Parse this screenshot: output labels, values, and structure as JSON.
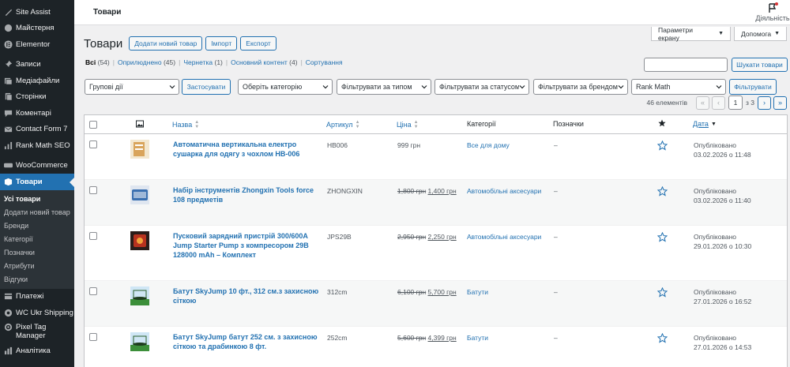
{
  "sidebar": {
    "items": [
      {
        "label": "Site Assist",
        "icon": "site-assist-icon"
      },
      {
        "label": "Майстерня",
        "icon": "dashboard-icon"
      },
      {
        "label": "Elementor",
        "icon": "elementor-icon"
      },
      {
        "label": "Записи",
        "icon": "pin-icon"
      },
      {
        "label": "Медіафайли",
        "icon": "media-icon"
      },
      {
        "label": "Сторінки",
        "icon": "pages-icon"
      },
      {
        "label": "Коментарі",
        "icon": "comments-icon"
      },
      {
        "label": "Contact Form 7",
        "icon": "mail-icon"
      },
      {
        "label": "Rank Math SEO",
        "icon": "rank-math-icon"
      },
      {
        "label": "WooCommerce",
        "icon": "woocommerce-icon"
      },
      {
        "label": "Товари",
        "icon": "products-icon"
      }
    ],
    "submenu": [
      "Усі товари",
      "Додати новий товар",
      "Бренди",
      "Категорії",
      "Позначки",
      "Атрибути",
      "Відгуки"
    ],
    "after": [
      {
        "label": "Платежі",
        "icon": "payments-icon"
      },
      {
        "label": "WC Ukr Shipping",
        "icon": "shipping-icon"
      },
      {
        "label": "Pixel Tag Manager",
        "icon": "pixel-icon"
      },
      {
        "label": "Аналітика",
        "icon": "analytics-icon"
      }
    ]
  },
  "topbar": {
    "title": "Товари",
    "activity": "Діяльність"
  },
  "screen_options": {
    "params": "Параметри екрану",
    "help": "Допомога"
  },
  "header": {
    "title": "Товари",
    "add_new": "Додати новий товар",
    "import": "Імпорт",
    "export": "Експорт"
  },
  "views": {
    "all": "Всі",
    "all_count": "(54)",
    "published": "Оприлюднено",
    "published_count": "(45)",
    "draft": "Чернетка",
    "draft_count": "(1)",
    "featured": "Основний контент",
    "featured_count": "(4)",
    "sort": "Сортування"
  },
  "search": {
    "button": "Шукати товари",
    "value": ""
  },
  "filters": {
    "bulk": "Групові дії",
    "apply": "Застосувати",
    "category": "Оберіть категорію",
    "type": "Фільтрувати за типом",
    "status": "Фільтрувати за статусом",
    "brand": "Фільтрувати за брендом",
    "rankmath": "Rank Math",
    "filter_btn": "Фільтрувати"
  },
  "pagination": {
    "count": "46 елементів",
    "first": "«",
    "prev": "‹",
    "current": "1",
    "of": "з 3",
    "next": "›",
    "last": "»"
  },
  "table": {
    "columns": {
      "name": "Назва",
      "sku": "Артикул",
      "price": "Ціна",
      "categories": "Категорії",
      "tags": "Позначки",
      "date": "Дата"
    },
    "rows": [
      {
        "name": "Автоматична вертикальна електро сушарка для одягу з чохлом HB-006",
        "sku": "HB006",
        "price_old": "",
        "price": "999 грн",
        "category": "Все для дому",
        "tags": "–",
        "status": "Опубліковано",
        "date": "03.02.2026 о 11:48",
        "thumb": "#d9a45b"
      },
      {
        "name": "Набір інструментів Zhongxin Tools force 108 предметів",
        "sku": "ZHONGXIN",
        "price_old": "1,800 грн",
        "price": "1,400 грн",
        "category": "Автомобільні аксесуари",
        "tags": "–",
        "status": "Опубліковано",
        "date": "03.02.2026 о 11:40",
        "thumb": "#3a6fb0"
      },
      {
        "name": "Пусковий зарядний пристрій 300/600А Jump Starter Pump з компресором 29В 128000 mAh – Комплект",
        "sku": "JPS29B",
        "price_old": "2,950 грн",
        "price": "2,250 грн",
        "category": "Автомобільні аксесуари",
        "tags": "–",
        "status": "Опубліковано",
        "date": "29.01.2026 о 10:30",
        "thumb": "#b8321f"
      },
      {
        "name": "Батут SkyJump 10 фт., 312 см.з захисною сіткою",
        "sku": "312cm",
        "price_old": "6,100 грн",
        "price": "5,700 грн",
        "category": "Батути",
        "tags": "–",
        "status": "Опубліковано",
        "date": "27.01.2026 о 16:52",
        "thumb": "#3c8f3a"
      },
      {
        "name": "Батут SkyJump батут 252 см. з захисною сіткою та драбинкою 8 фт.",
        "sku": "252cm",
        "price_old": "5,600 грн",
        "price": "4,399 грн",
        "category": "Батути",
        "tags": "–",
        "status": "Опубліковано",
        "date": "27.01.2026 о 14:53",
        "thumb": "#3c8f3a"
      }
    ]
  },
  "colors": {
    "accent": "#2271b1",
    "sidebar": "#1d2327",
    "active": "#2271b1"
  }
}
